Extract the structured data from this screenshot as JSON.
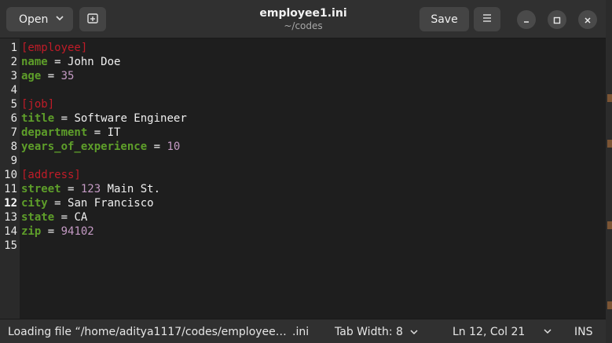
{
  "header": {
    "open_label": "Open",
    "save_label": "Save",
    "title": "employee1.ini",
    "subtitle": "~/codes"
  },
  "editor": {
    "line_numbers": [
      "1",
      "2",
      "3",
      "4",
      "5",
      "6",
      "7",
      "8",
      "9",
      "10",
      "11",
      "12",
      "13",
      "14",
      "15"
    ],
    "current_line": "12",
    "lines": [
      {
        "section": "[employee]"
      },
      {
        "key": "name",
        "eq": " = ",
        "value": "John Doe",
        "numeric": false
      },
      {
        "key": "age",
        "eq": " = ",
        "value": "35",
        "numeric": true
      },
      {},
      {
        "section": "[job]"
      },
      {
        "key": "title",
        "eq": " = ",
        "value": "Software Engineer",
        "numeric": false
      },
      {
        "key": "department",
        "eq": " = ",
        "value": "IT",
        "numeric": false
      },
      {
        "key": "years_of_experience",
        "eq": " = ",
        "value": "10",
        "numeric": true
      },
      {},
      {
        "section": "[address]"
      },
      {
        "key": "street",
        "eq": " = ",
        "value_num": "123",
        "value_rest": " Main St."
      },
      {
        "key": "city",
        "eq": " = ",
        "value": "San Francisco",
        "numeric": false
      },
      {
        "key": "state",
        "eq": " = ",
        "value": "CA",
        "numeric": false
      },
      {
        "key": "zip",
        "eq": " = ",
        "value": "94102",
        "numeric": true
      },
      {}
    ]
  },
  "statusbar": {
    "loading": "Loading file “/home/aditya1117/codes/employee…",
    "language": ".ini",
    "tab_width": "Tab Width: 8",
    "position": "Ln 12, Col 21",
    "mode": "INS"
  },
  "colors": {
    "section": "#c01c28",
    "key": "#5e9e2a",
    "number": "#c49ac4"
  },
  "icons": [
    "chevron-down-icon",
    "new-tab-icon",
    "hamburger-menu-icon",
    "minimize-icon",
    "maximize-icon",
    "close-icon"
  ]
}
